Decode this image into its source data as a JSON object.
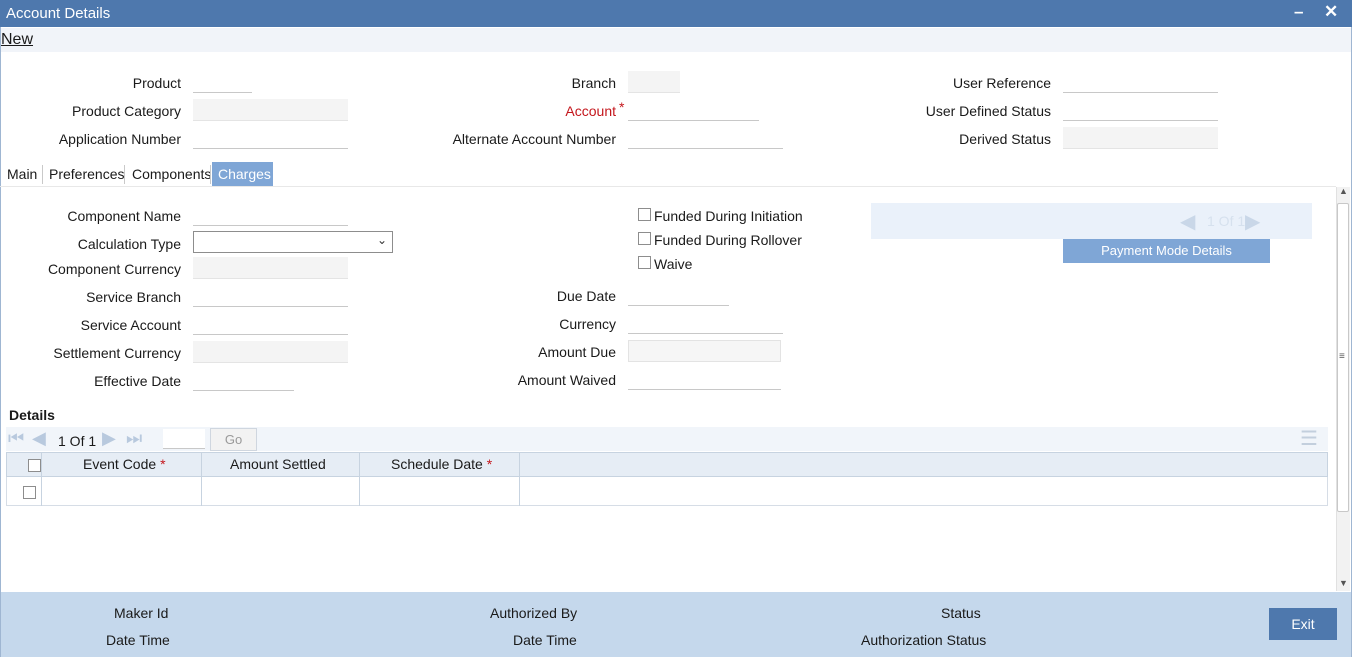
{
  "window": {
    "title": "Account Details"
  },
  "menu": {
    "new_label": "New"
  },
  "header": {
    "product_label": "Product",
    "product_category_label": "Product Category",
    "application_number_label": "Application Number",
    "branch_label": "Branch",
    "account_label": "Account",
    "alternate_account_number_label": "Alternate Account Number",
    "user_reference_label": "User Reference",
    "user_defined_status_label": "User Defined Status",
    "derived_status_label": "Derived Status",
    "required_marker": "*"
  },
  "tabs": [
    {
      "label": "Main"
    },
    {
      "label": "Preferences"
    },
    {
      "label": "Components"
    },
    {
      "label": "Charges",
      "active": true
    }
  ],
  "charges": {
    "component_name_label": "Component Name",
    "calculation_type_label": "Calculation Type",
    "component_currency_label": "Component Currency",
    "service_branch_label": "Service Branch",
    "service_account_label": "Service Account",
    "settlement_currency_label": "Settlement Currency",
    "effective_date_label": "Effective Date",
    "funded_during_initiation_label": "Funded During Initiation",
    "funded_during_rollover_label": "Funded During Rollover",
    "waive_label": "Waive",
    "due_date_label": "Due Date",
    "currency_label": "Currency",
    "amount_due_label": "Amount Due",
    "amount_waived_label": "Amount Waived",
    "record_pager_text": "1 Of 1",
    "payment_mode_details_label": "Payment Mode Details"
  },
  "details": {
    "title": "Details",
    "pager_text": "1 Of 1",
    "go_label": "Go",
    "columns": [
      {
        "label": "Event Code",
        "required": true
      },
      {
        "label": "Amount Settled",
        "required": false
      },
      {
        "label": "Schedule Date",
        "required": true
      }
    ]
  },
  "footer": {
    "maker_id_label": "Maker Id",
    "date_time_label": "Date Time",
    "authorized_by_label": "Authorized By",
    "checker_date_time_label": "Date Time",
    "status_label": "Status",
    "authorization_status_label": "Authorization Status",
    "exit_label": "Exit"
  },
  "colors": {
    "titlebar": "#4e78ad",
    "tab_active": "#7fa6d6",
    "footer": "#c5d8ec",
    "required": "#c4161c"
  }
}
